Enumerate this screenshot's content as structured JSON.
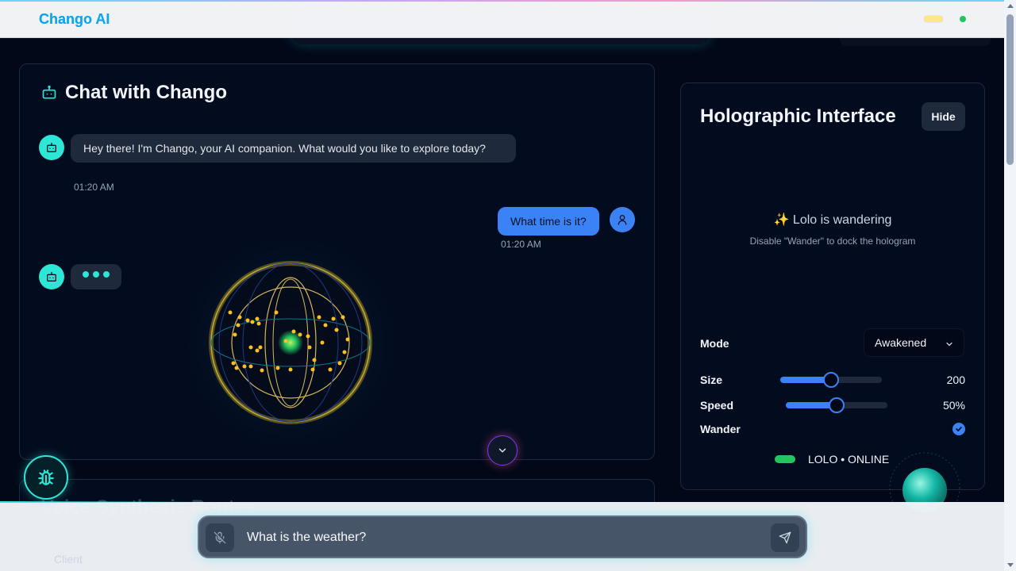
{
  "header": {
    "brand": "Chango AI",
    "ghost_nav_label": "Chango AI"
  },
  "chat": {
    "title": "Chat with Chango",
    "messages": [
      {
        "role": "bot",
        "text": "Hey there! I'm Chango, your AI companion. What would you like to explore today?",
        "time": "01:20 AM"
      },
      {
        "role": "user",
        "text": "What time is it?",
        "time": "01:20 AM"
      }
    ]
  },
  "voice": {
    "title": "Voice Synthesis Routes",
    "ghost_item": "Client"
  },
  "holo": {
    "title": "Holographic Interface",
    "hide_label": "Hide",
    "wander_message": "✨ Lolo is wandering",
    "wander_sub": "Disable \"Wander\" to dock the hologram",
    "mode_label": "Mode",
    "mode_value": "Awakened",
    "size_label": "Size",
    "size_value": "200",
    "size_fraction": 0.5,
    "speed_label": "Speed",
    "speed_value": "50%",
    "speed_fraction": 0.5,
    "wander_label": "Wander",
    "wander_checked": true,
    "status_text": "LOLO • ONLINE"
  },
  "input": {
    "value": "What is the weather?"
  },
  "icons": {
    "topbar_toggle": "toggle-icon",
    "status": "status-dot-icon",
    "bot": "bot-icon",
    "user": "user-icon",
    "mic_off": "mic-off-icon",
    "send": "send-icon",
    "debug": "bug-icon",
    "chevron": "chevron-down-icon",
    "check": "check-icon"
  },
  "colors": {
    "accent": "#3b82f6",
    "teal": "#2ee6d6",
    "online": "#22c55e",
    "background": "#020817"
  }
}
